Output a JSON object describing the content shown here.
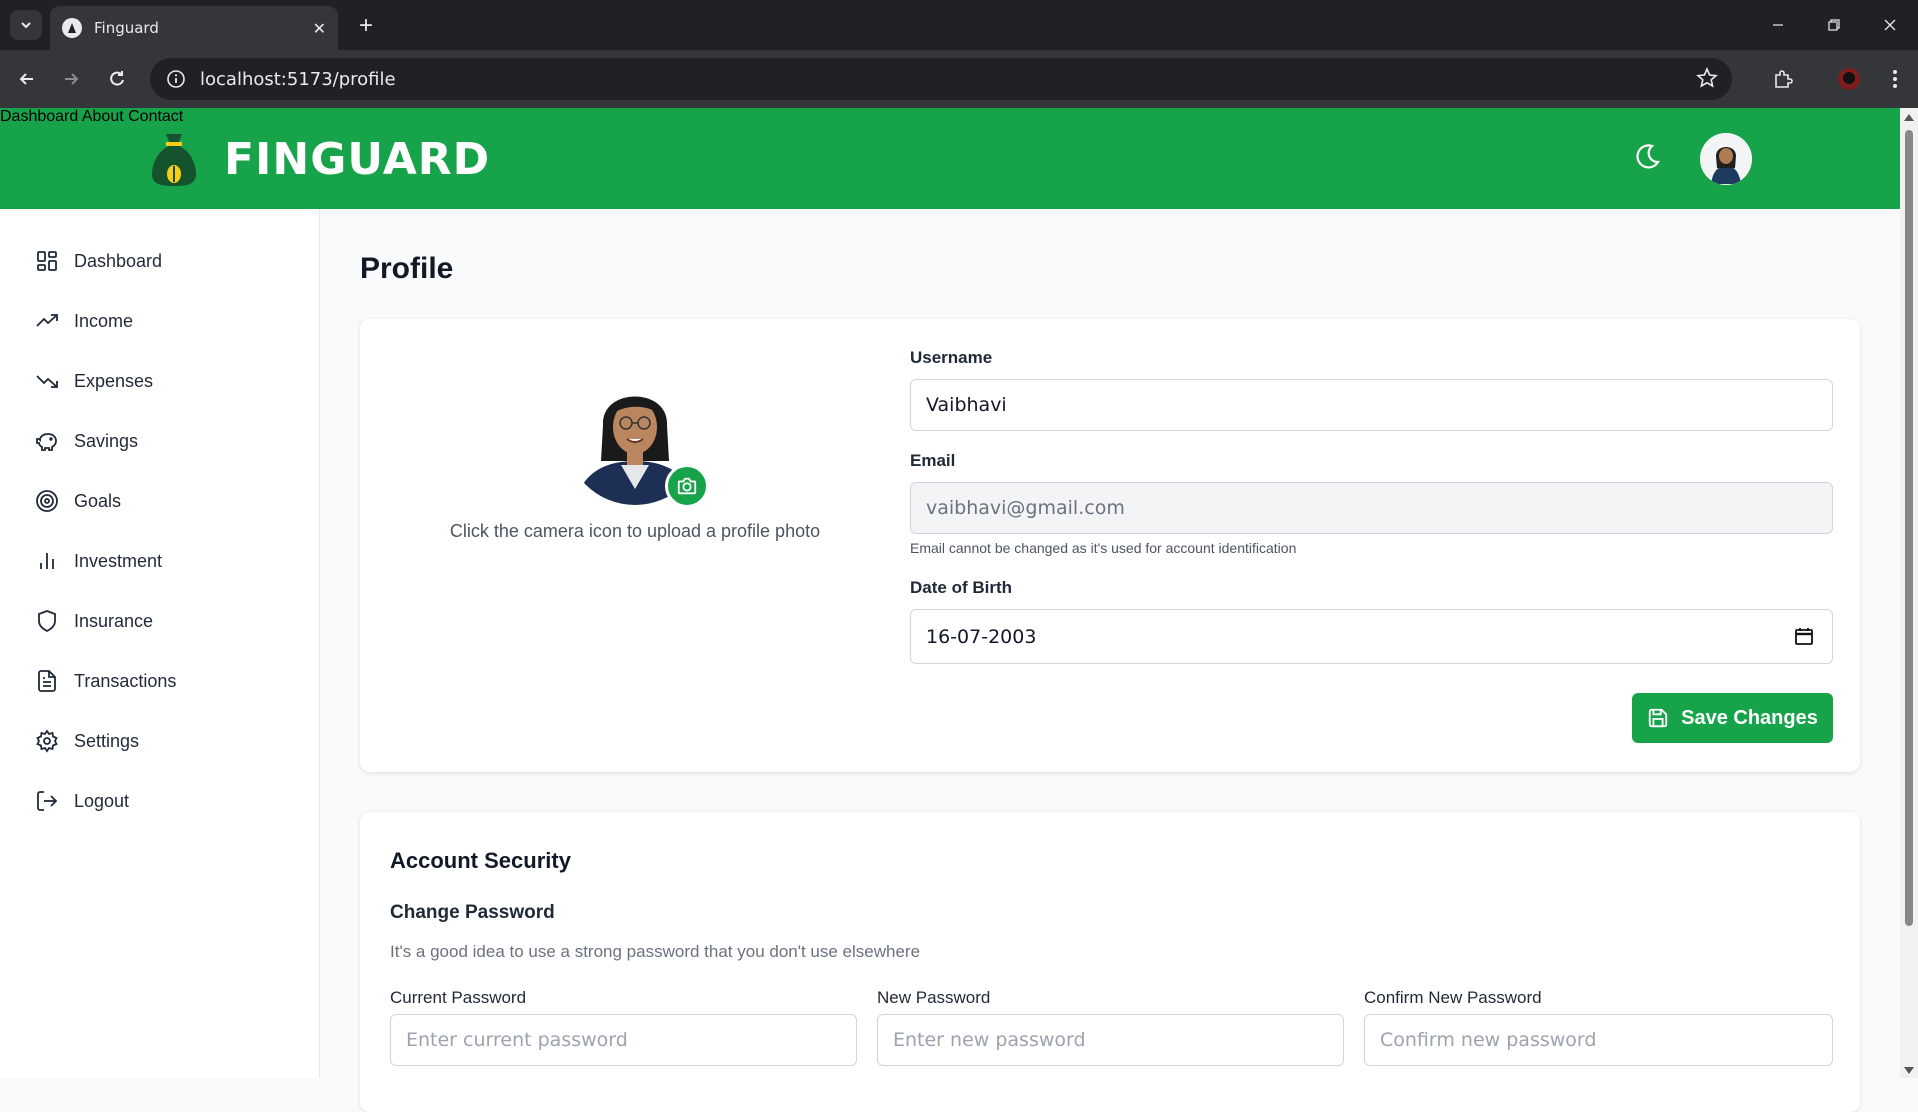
{
  "browser": {
    "tab_title": "Finguard",
    "url": "localhost:5173/profile"
  },
  "header": {
    "brand": "FINGUARD",
    "nav": [
      "Dashboard",
      "About",
      "Contact"
    ]
  },
  "sidebar": {
    "items": [
      {
        "label": "Dashboard",
        "icon": "dashboard-grid-icon"
      },
      {
        "label": "Income",
        "icon": "trend-up-icon"
      },
      {
        "label": "Expenses",
        "icon": "trend-down-icon"
      },
      {
        "label": "Savings",
        "icon": "piggy-bank-icon"
      },
      {
        "label": "Goals",
        "icon": "target-icon"
      },
      {
        "label": "Investment",
        "icon": "bar-chart-icon"
      },
      {
        "label": "Insurance",
        "icon": "shield-icon"
      },
      {
        "label": "Transactions",
        "icon": "document-icon"
      },
      {
        "label": "Settings",
        "icon": "gear-icon"
      },
      {
        "label": "Logout",
        "icon": "logout-icon"
      }
    ]
  },
  "page": {
    "title": "Profile"
  },
  "profile": {
    "photo_hint": "Click the camera icon to upload a profile photo",
    "username_label": "Username",
    "username_value": "Vaibhavi",
    "email_label": "Email",
    "email_value": "vaibhavi@gmail.com",
    "email_helper": "Email cannot be changed as it's used for account identification",
    "dob_label": "Date of Birth",
    "dob_value": "16-07-2003",
    "save_label": "Save Changes"
  },
  "security": {
    "title": "Account Security",
    "subtitle": "Change Password",
    "description": "It's a good idea to use a strong password that you don't use elsewhere",
    "current_label": "Current Password",
    "current_placeholder": "Enter current password",
    "new_label": "New Password",
    "new_placeholder": "Enter new password",
    "confirm_label": "Confirm New Password",
    "confirm_placeholder": "Confirm new password"
  },
  "colors": {
    "brand_green": "#16a34a"
  }
}
